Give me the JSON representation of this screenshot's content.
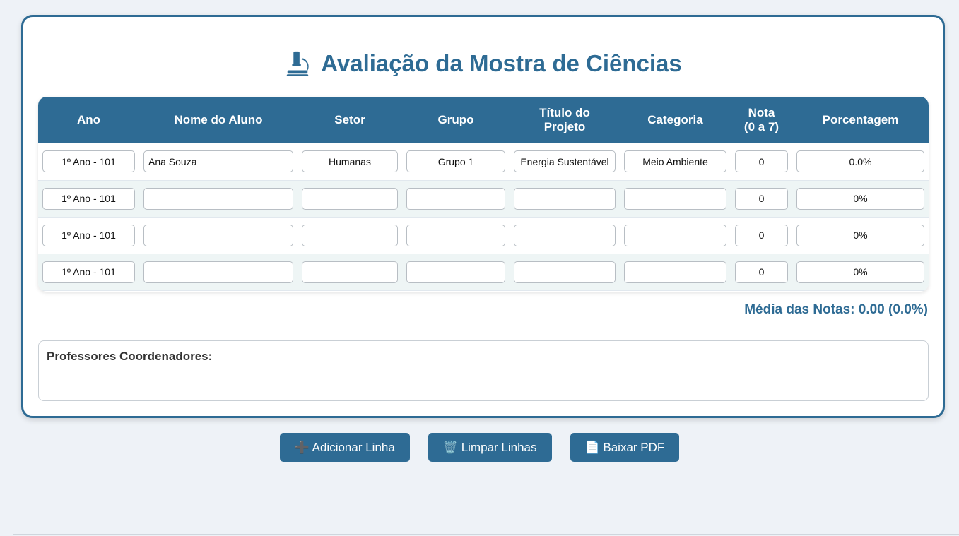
{
  "title": "Avaliação da Mostra de Ciências",
  "title_icon": "microscope-icon",
  "colors": {
    "primary": "#2e6b94",
    "background": "#eef2f7"
  },
  "table": {
    "headers": [
      "Ano",
      "Nome do Aluno",
      "Setor",
      "Grupo",
      "Título do Projeto",
      "Categoria",
      "Nota (0 a 7)",
      "Porcentagem"
    ],
    "rows": [
      {
        "ano": "1º Ano - 101",
        "nome": "Ana Souza",
        "setor": "Humanas",
        "grupo": "Grupo 1",
        "titulo": "Energia Sustentável",
        "categoria": "Meio Ambiente",
        "nota": "0",
        "porcentagem": "0.0%"
      },
      {
        "ano": "1º Ano - 101",
        "nome": "",
        "setor": "",
        "grupo": "",
        "titulo": "",
        "categoria": "",
        "nota": "0",
        "porcentagem": "0%"
      },
      {
        "ano": "1º Ano - 101",
        "nome": "",
        "setor": "",
        "grupo": "",
        "titulo": "",
        "categoria": "",
        "nota": "0",
        "porcentagem": "0%"
      },
      {
        "ano": "1º Ano - 101",
        "nome": "",
        "setor": "",
        "grupo": "",
        "titulo": "",
        "categoria": "",
        "nota": "0",
        "porcentagem": "0%"
      }
    ]
  },
  "media": "Média das Notas: 0.00 (0.0%)",
  "professores_label": "Professores Coordenadores:",
  "buttons": {
    "adicionar": "➕ Adicionar Linha",
    "limpar": "🗑️ Limpar Linhas",
    "baixar": "📄 Baixar PDF"
  }
}
